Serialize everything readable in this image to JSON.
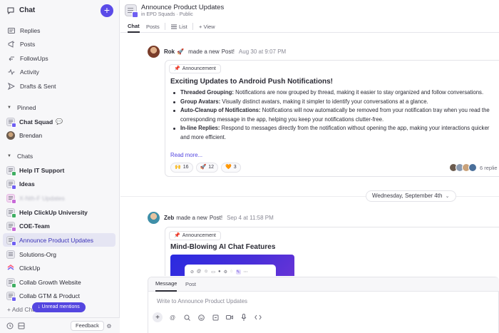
{
  "sidebar": {
    "title": "Chat",
    "new_button_label": "+",
    "nav": [
      {
        "label": "Replies",
        "icon": "replies-icon"
      },
      {
        "label": "Posts",
        "icon": "posts-icon"
      },
      {
        "label": "FollowUps",
        "icon": "followups-icon"
      },
      {
        "label": "Activity",
        "icon": "activity-icon"
      },
      {
        "label": "Drafts & Sent",
        "icon": "send-icon"
      }
    ],
    "pinned_label": "Pinned",
    "pinned": [
      {
        "label": "Chat Squad",
        "suffix": "💬"
      },
      {
        "label": "Brendan"
      }
    ],
    "chats_label": "Chats",
    "chats": [
      {
        "label": "Help IT Support"
      },
      {
        "label": "Ideas"
      },
      {
        "label": "X-Nth-F Updates"
      },
      {
        "label": "Help ClickUp University"
      },
      {
        "label": "COE-Team"
      },
      {
        "label": "Announce Product Updates"
      },
      {
        "label": "Solutions-Org"
      },
      {
        "label": "ClickUp"
      },
      {
        "label": "Collab Growth Website"
      },
      {
        "label": "Collab GTM & Product"
      }
    ],
    "add_chat_label": "+ Add Chat",
    "unread_label": "↓ Unread mentions",
    "feedback_label": "Feedback"
  },
  "channel": {
    "title": "Announce Product Updates",
    "subtitle": "in EPD Squads · Public",
    "tabs": [
      {
        "label": "Chat"
      },
      {
        "label": "Posts"
      },
      {
        "label": "List"
      },
      {
        "label": "+ View"
      }
    ]
  },
  "posts": [
    {
      "author": "Rok",
      "author_emoji": "🚀",
      "verb": "made a new",
      "object": "Post!",
      "time": "Aug 30 at 9:07 PM",
      "tag": "Announcement",
      "title": "Exciting Updates to Android Push Notifications!",
      "bullets": [
        {
          "bold": "Threaded Grouping:",
          "text": " Notifications are now grouped by thread, making it easier to stay organized and follow conversations."
        },
        {
          "bold": "Group Avatars:",
          "text": " Visually distinct avatars, making it simpler to identify your conversations at a glance."
        },
        {
          "bold": "Auto-Cleanup of Notifications:",
          "text": " Notifications will now automatically be removed from your notification tray when you read the corresponding message in the app, helping you keep your notifications clutter-free."
        },
        {
          "bold": "In-line Replies:",
          "text": " Respond to messages directly from the notification without opening the app, making your interactions quicker and more efficient."
        }
      ],
      "read_more": "Read more...",
      "reactions": [
        {
          "emoji": "🙌",
          "count": "16"
        },
        {
          "emoji": "🚀",
          "count": "12"
        },
        {
          "emoji": "🧡",
          "count": "3"
        }
      ],
      "replies_label": "6 replie"
    },
    {
      "author": "Zeb",
      "verb": "made a new",
      "object": "Post!",
      "time": "Sep 4 at 11:58 PM",
      "tag": "Announcement",
      "title": "Mind-Blowing AI Chat Features"
    }
  ],
  "date_separator": "Wednesday, September 4th",
  "composer": {
    "tabs": [
      "Message",
      "Post"
    ],
    "placeholder": "Write to Announce Product Updates"
  },
  "colors": {
    "accent": "#5b4be8",
    "link": "#5446e0",
    "sidebar_bg": "#f7f7f9",
    "active_item_bg": "#e5e5f3"
  }
}
